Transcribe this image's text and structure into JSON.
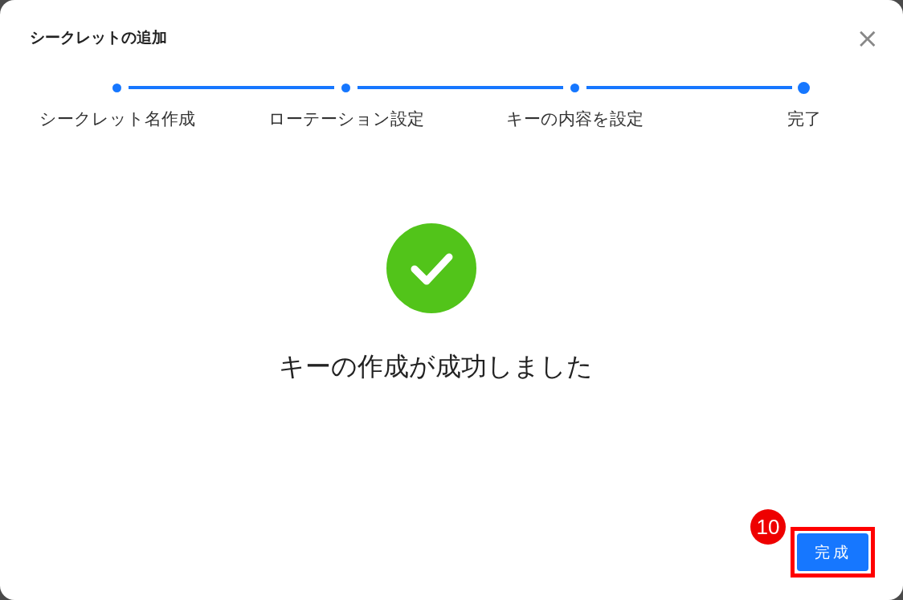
{
  "dialog": {
    "title": "シークレットの追加",
    "close": "×"
  },
  "steps": [
    {
      "label": "シークレット名作成",
      "selected": false
    },
    {
      "label": "ローテーション設定",
      "selected": false
    },
    {
      "label": "キーの内容を設定",
      "selected": false
    },
    {
      "label": "完了",
      "selected": true
    }
  ],
  "result": {
    "kind": "success",
    "message": "キーの作成が成功しました"
  },
  "buttons": [
    {
      "label": "完成",
      "highlighted": true,
      "annotation": "10"
    }
  ]
}
